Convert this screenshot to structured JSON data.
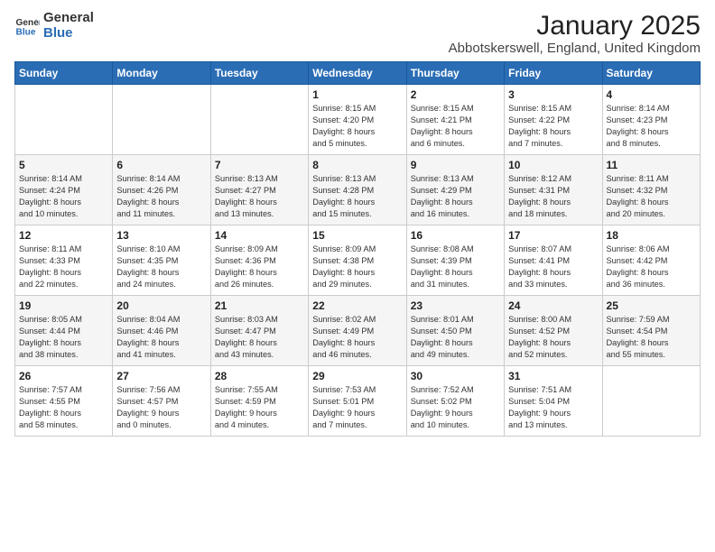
{
  "header": {
    "logo_general": "General",
    "logo_blue": "Blue",
    "title": "January 2025",
    "subtitle": "Abbotskerswell, England, United Kingdom"
  },
  "days_of_week": [
    "Sunday",
    "Monday",
    "Tuesday",
    "Wednesday",
    "Thursday",
    "Friday",
    "Saturday"
  ],
  "weeks": [
    [
      {
        "day": "",
        "content": ""
      },
      {
        "day": "",
        "content": ""
      },
      {
        "day": "",
        "content": ""
      },
      {
        "day": "1",
        "content": "Sunrise: 8:15 AM\nSunset: 4:20 PM\nDaylight: 8 hours\nand 5 minutes."
      },
      {
        "day": "2",
        "content": "Sunrise: 8:15 AM\nSunset: 4:21 PM\nDaylight: 8 hours\nand 6 minutes."
      },
      {
        "day": "3",
        "content": "Sunrise: 8:15 AM\nSunset: 4:22 PM\nDaylight: 8 hours\nand 7 minutes."
      },
      {
        "day": "4",
        "content": "Sunrise: 8:14 AM\nSunset: 4:23 PM\nDaylight: 8 hours\nand 8 minutes."
      }
    ],
    [
      {
        "day": "5",
        "content": "Sunrise: 8:14 AM\nSunset: 4:24 PM\nDaylight: 8 hours\nand 10 minutes."
      },
      {
        "day": "6",
        "content": "Sunrise: 8:14 AM\nSunset: 4:26 PM\nDaylight: 8 hours\nand 11 minutes."
      },
      {
        "day": "7",
        "content": "Sunrise: 8:13 AM\nSunset: 4:27 PM\nDaylight: 8 hours\nand 13 minutes."
      },
      {
        "day": "8",
        "content": "Sunrise: 8:13 AM\nSunset: 4:28 PM\nDaylight: 8 hours\nand 15 minutes."
      },
      {
        "day": "9",
        "content": "Sunrise: 8:13 AM\nSunset: 4:29 PM\nDaylight: 8 hours\nand 16 minutes."
      },
      {
        "day": "10",
        "content": "Sunrise: 8:12 AM\nSunset: 4:31 PM\nDaylight: 8 hours\nand 18 minutes."
      },
      {
        "day": "11",
        "content": "Sunrise: 8:11 AM\nSunset: 4:32 PM\nDaylight: 8 hours\nand 20 minutes."
      }
    ],
    [
      {
        "day": "12",
        "content": "Sunrise: 8:11 AM\nSunset: 4:33 PM\nDaylight: 8 hours\nand 22 minutes."
      },
      {
        "day": "13",
        "content": "Sunrise: 8:10 AM\nSunset: 4:35 PM\nDaylight: 8 hours\nand 24 minutes."
      },
      {
        "day": "14",
        "content": "Sunrise: 8:09 AM\nSunset: 4:36 PM\nDaylight: 8 hours\nand 26 minutes."
      },
      {
        "day": "15",
        "content": "Sunrise: 8:09 AM\nSunset: 4:38 PM\nDaylight: 8 hours\nand 29 minutes."
      },
      {
        "day": "16",
        "content": "Sunrise: 8:08 AM\nSunset: 4:39 PM\nDaylight: 8 hours\nand 31 minutes."
      },
      {
        "day": "17",
        "content": "Sunrise: 8:07 AM\nSunset: 4:41 PM\nDaylight: 8 hours\nand 33 minutes."
      },
      {
        "day": "18",
        "content": "Sunrise: 8:06 AM\nSunset: 4:42 PM\nDaylight: 8 hours\nand 36 minutes."
      }
    ],
    [
      {
        "day": "19",
        "content": "Sunrise: 8:05 AM\nSunset: 4:44 PM\nDaylight: 8 hours\nand 38 minutes."
      },
      {
        "day": "20",
        "content": "Sunrise: 8:04 AM\nSunset: 4:46 PM\nDaylight: 8 hours\nand 41 minutes."
      },
      {
        "day": "21",
        "content": "Sunrise: 8:03 AM\nSunset: 4:47 PM\nDaylight: 8 hours\nand 43 minutes."
      },
      {
        "day": "22",
        "content": "Sunrise: 8:02 AM\nSunset: 4:49 PM\nDaylight: 8 hours\nand 46 minutes."
      },
      {
        "day": "23",
        "content": "Sunrise: 8:01 AM\nSunset: 4:50 PM\nDaylight: 8 hours\nand 49 minutes."
      },
      {
        "day": "24",
        "content": "Sunrise: 8:00 AM\nSunset: 4:52 PM\nDaylight: 8 hours\nand 52 minutes."
      },
      {
        "day": "25",
        "content": "Sunrise: 7:59 AM\nSunset: 4:54 PM\nDaylight: 8 hours\nand 55 minutes."
      }
    ],
    [
      {
        "day": "26",
        "content": "Sunrise: 7:57 AM\nSunset: 4:55 PM\nDaylight: 8 hours\nand 58 minutes."
      },
      {
        "day": "27",
        "content": "Sunrise: 7:56 AM\nSunset: 4:57 PM\nDaylight: 9 hours\nand 0 minutes."
      },
      {
        "day": "28",
        "content": "Sunrise: 7:55 AM\nSunset: 4:59 PM\nDaylight: 9 hours\nand 4 minutes."
      },
      {
        "day": "29",
        "content": "Sunrise: 7:53 AM\nSunset: 5:01 PM\nDaylight: 9 hours\nand 7 minutes."
      },
      {
        "day": "30",
        "content": "Sunrise: 7:52 AM\nSunset: 5:02 PM\nDaylight: 9 hours\nand 10 minutes."
      },
      {
        "day": "31",
        "content": "Sunrise: 7:51 AM\nSunset: 5:04 PM\nDaylight: 9 hours\nand 13 minutes."
      },
      {
        "day": "",
        "content": ""
      }
    ]
  ]
}
